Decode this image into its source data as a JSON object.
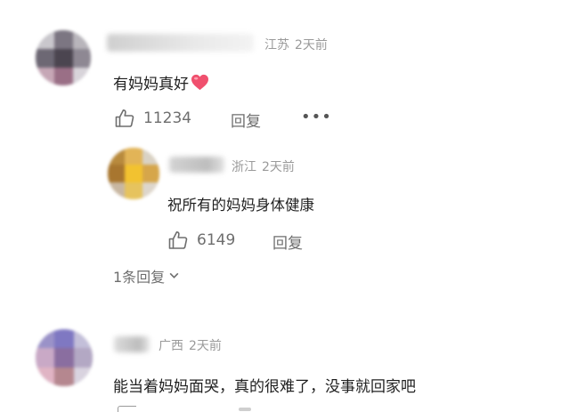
{
  "comments": [
    {
      "location": "江苏",
      "time": "2天前",
      "text": "有妈妈真好",
      "emoji": "heart-emoji",
      "likes": "11234",
      "reply_label": "回复",
      "more_label": "•••",
      "replies": [
        {
          "location": "浙江",
          "time": "2天前",
          "text": "祝所有的妈妈身体健康",
          "likes": "6149",
          "reply_label": "回复"
        }
      ],
      "expand_label": "1条回复"
    },
    {
      "location": "广西",
      "time": "2天前",
      "text": "能当着妈妈面哭，真的很难了，没事就回家吧"
    }
  ],
  "colors": {
    "meta": "#9a9a9a",
    "action": "#6e6e6e",
    "heart": "#f0506e"
  }
}
